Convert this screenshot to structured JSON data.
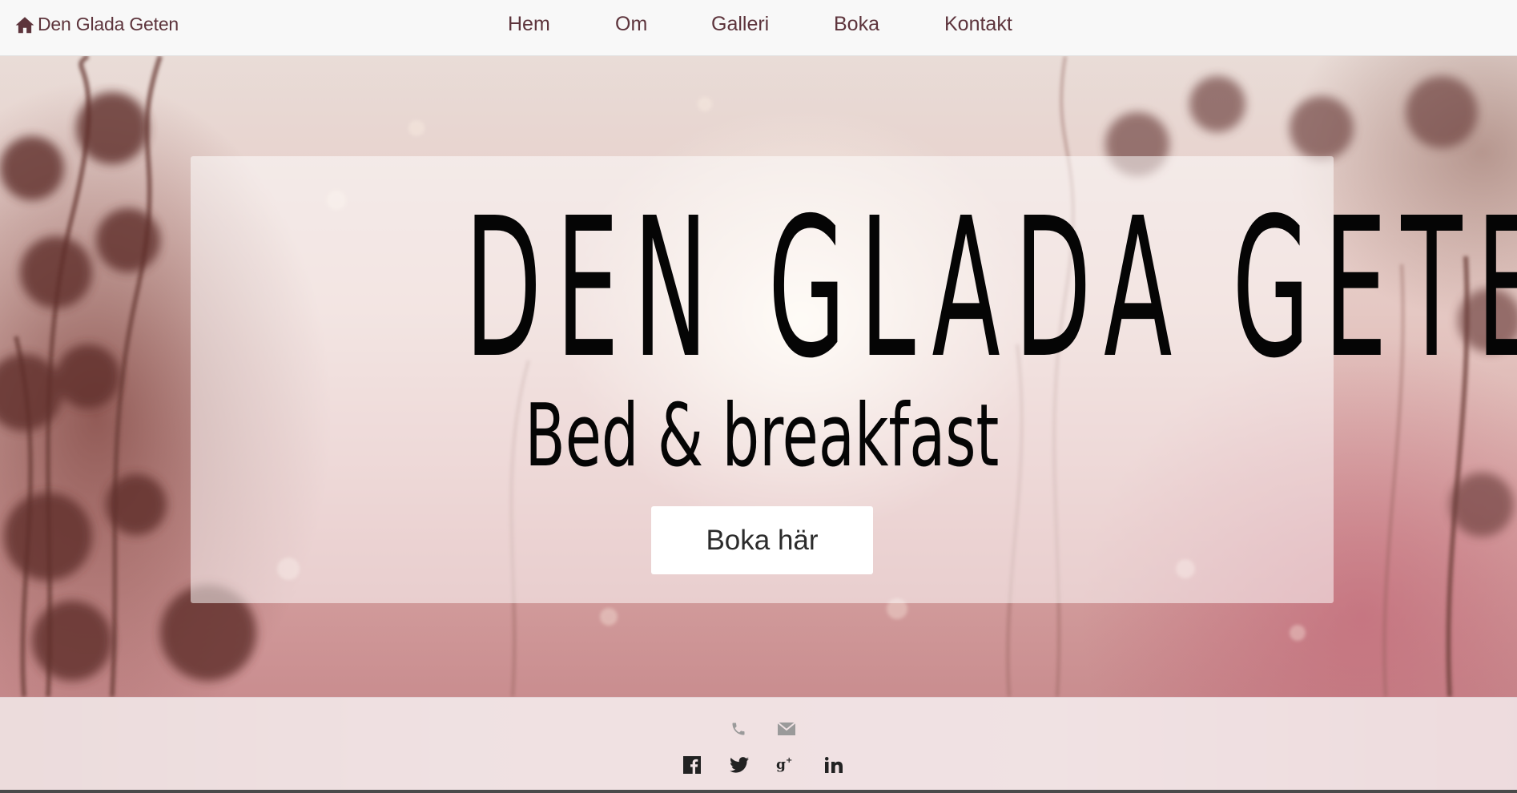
{
  "navbar": {
    "brand": "Den Glada Geten",
    "brand_icon": "home-icon",
    "links": [
      {
        "label": "Hem"
      },
      {
        "label": "Om"
      },
      {
        "label": "Galleri"
      },
      {
        "label": "Boka"
      },
      {
        "label": "Kontakt"
      }
    ]
  },
  "hero": {
    "title": "DEN GLADA GETEN",
    "subtitle": "Bed & breakfast",
    "cta": "Boka här"
  },
  "footer": {
    "contact_icons": [
      "phone-icon",
      "mail-icon"
    ],
    "social_icons": [
      "facebook-icon",
      "twitter-icon",
      "google-plus-icon",
      "linkedin-icon"
    ]
  },
  "colors": {
    "nav_text": "#5d343c",
    "nav_bg": "#f8f8f8",
    "title_text": "#050505",
    "footer_icon_muted": "#9a9a9a",
    "footer_icon_dark": "#222222"
  }
}
